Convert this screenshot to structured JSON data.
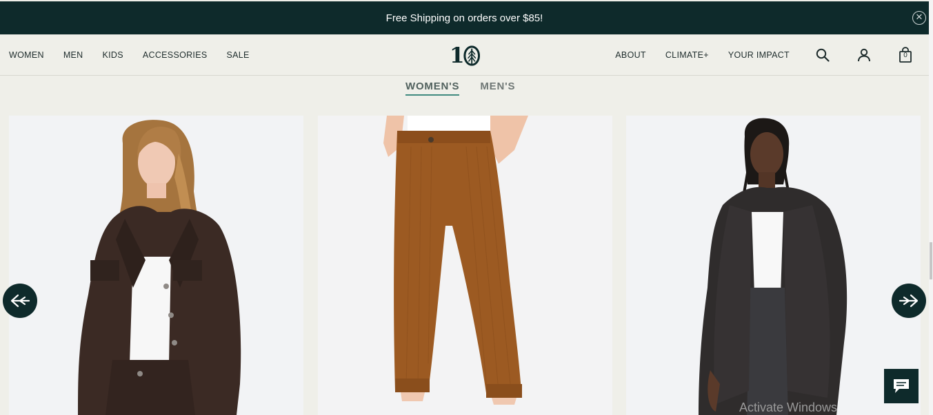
{
  "promo": {
    "text": "Free Shipping on orders over $85!",
    "close_icon": "close-circle-icon"
  },
  "nav": {
    "left": [
      "WOMEN",
      "MEN",
      "KIDS",
      "ACCESSORIES",
      "SALE"
    ],
    "right": [
      "ABOUT",
      "CLIMATE+",
      "YOUR IMPACT"
    ],
    "logo_text": "1"
  },
  "header_icons": {
    "search": "search-icon",
    "account": "account-icon",
    "cart": "cart-icon",
    "cart_count": "0"
  },
  "gender_tabs": {
    "women": "WOMEN'S",
    "men": "MEN'S",
    "active": "women"
  },
  "products": [
    {
      "alt": "Woman in dark brown corduroy jacket"
    },
    {
      "alt": "Brown corduroy cropped pants"
    },
    {
      "alt": "Woman in black long cardigan"
    }
  ],
  "carousel": {
    "prev_icon": "arrow-left-icon",
    "next_icon": "arrow-right-icon"
  },
  "chat": {
    "icon": "chat-icon"
  },
  "watermark": {
    "text": "Activate Windows"
  },
  "colors": {
    "brand_dark": "#0e2a2b",
    "background": "#efefe9",
    "tab_underline": "#3f8a7f"
  }
}
